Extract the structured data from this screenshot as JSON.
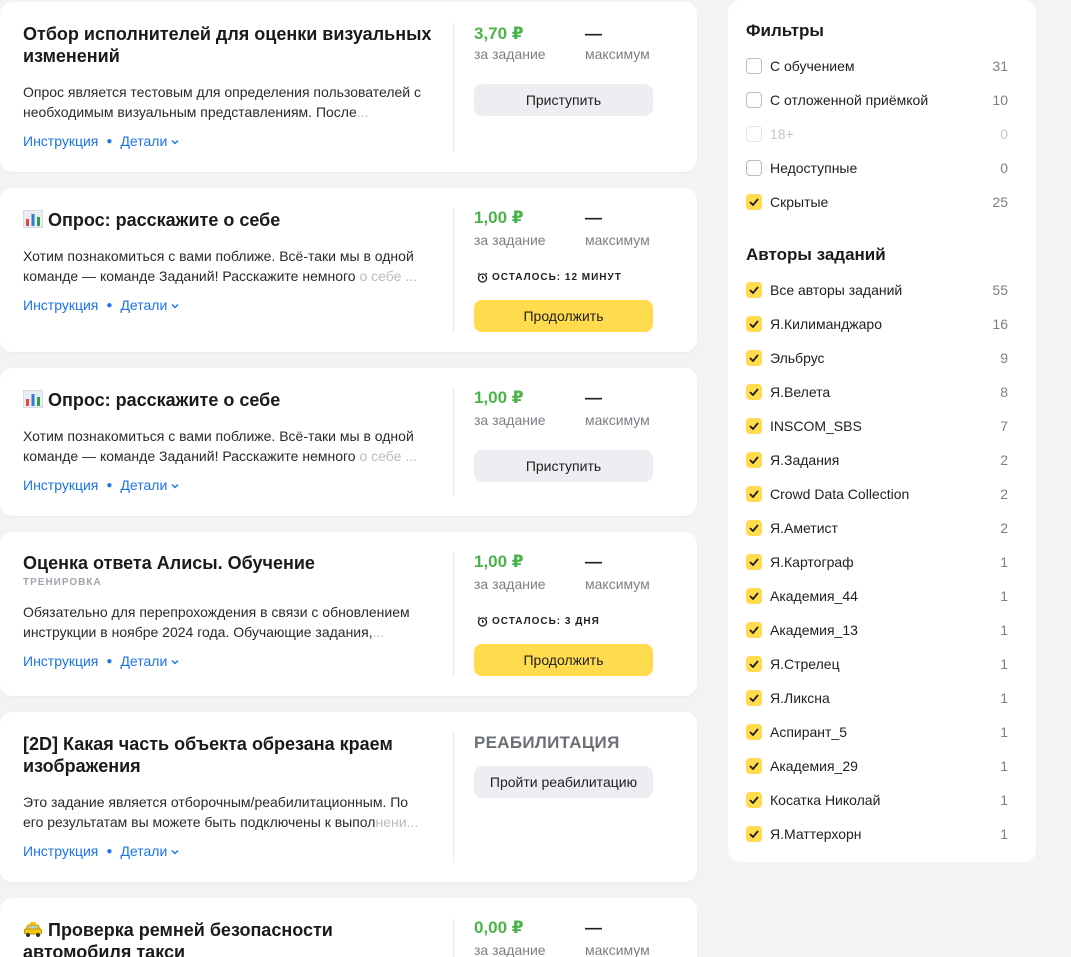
{
  "cards": [
    {
      "title_lines": [
        "Отбор исполнителей для оценки визуальных",
        "изменений"
      ],
      "desc_lines": [
        "Опрос является тестовым для определения пользователей с",
        "необходимым визуальным представлениям. После"
      ],
      "desc_fade": "...",
      "price": "3,70 ₽",
      "price_label": "за задание",
      "max": "—",
      "max_label": "максимум",
      "button": "Приступить",
      "instr": "Инструкция",
      "details": "Детали"
    },
    {
      "title": "Опрос: расскажите о себе",
      "desc_lines": [
        "Хотим познакомиться с вами поближе. Всё-таки мы в одной",
        "команде — команде Заданий! Расскажите немного"
      ],
      "desc_fade": "о себе ...",
      "price": "1,00 ₽",
      "price_label": "за задание",
      "max": "—",
      "max_label": "максимум",
      "timer": "ОСТАЛОСЬ: 12 МИНУТ",
      "button": "Продолжить",
      "instr": "Инструкция",
      "details": "Детали"
    },
    {
      "title": "Опрос: расскажите о себе",
      "desc_lines": [
        "Хотим познакомиться с вами поближе. Всё-таки мы в одной",
        "команде — команде Заданий! Расскажите немного"
      ],
      "desc_fade": "о себе ...",
      "price": "1,00 ₽",
      "price_label": "за задание",
      "max": "—",
      "max_label": "максимум",
      "button": "Приступить",
      "instr": "Инструкция",
      "details": "Детали"
    },
    {
      "title": "Оценка ответа Алисы. Обучение",
      "tag": "ТРЕНИРОВКА",
      "desc_lines": [
        "Обязательно для перепрохождения в связи с обновлением",
        "инструкции в ноябре 2024 года. Обучающие задания,"
      ],
      "desc_fade": "...",
      "price": "1,00 ₽",
      "price_label": "за задание",
      "max": "—",
      "max_label": "максимум",
      "timer": "ОСТАЛОСЬ: 3 ДНЯ",
      "button": "Продолжить",
      "instr": "Инструкция",
      "details": "Детали"
    },
    {
      "title_lines": [
        "[2D] Какая часть объекта обрезана краем",
        "изображения"
      ],
      "desc_lines": [
        "Это задание является отборочным/реабилитационным. По",
        "его результатам вы можете быть подключены к выпол"
      ],
      "desc_fade": "нени...",
      "status": "РЕАБИЛИТАЦИЯ",
      "button": "Пройти реабилитацию",
      "instr": "Инструкция",
      "details": "Детали"
    },
    {
      "title_lines": [
        "Проверка ремней безопасности",
        "автомобиля такси"
      ],
      "price": "0,00 ₽",
      "price_label": "за задание",
      "max": "—",
      "max_label": "максимум"
    }
  ],
  "filters": {
    "title": "Фильтры",
    "items": [
      {
        "label": "С обучением",
        "count": "31",
        "checked": false
      },
      {
        "label": "С отложенной приёмкой",
        "count": "10",
        "checked": false
      },
      {
        "label": "18+",
        "count": "0",
        "checked": false,
        "disabled": true
      },
      {
        "label": "Недоступные",
        "count": "0",
        "checked": false
      },
      {
        "label": "Скрытые",
        "count": "25",
        "checked": true
      }
    ]
  },
  "authors": {
    "title": "Авторы заданий",
    "items": [
      {
        "label": "Все авторы заданий",
        "count": "55"
      },
      {
        "label": "Я.Килиманджаро",
        "count": "16"
      },
      {
        "label": "Эльбрус",
        "count": "9"
      },
      {
        "label": "Я.Велета",
        "count": "8"
      },
      {
        "label": "INSCOM_SBS",
        "count": "7"
      },
      {
        "label": "Я.Задания",
        "count": "2"
      },
      {
        "label": "Crowd Data Collection",
        "count": "2"
      },
      {
        "label": "Я.Аметист",
        "count": "2"
      },
      {
        "label": "Я.Картограф",
        "count": "1"
      },
      {
        "label": "Академия_44",
        "count": "1"
      },
      {
        "label": "Академия_13",
        "count": "1"
      },
      {
        "label": "Я.Стрелец",
        "count": "1"
      },
      {
        "label": "Я.Ликсна",
        "count": "1"
      },
      {
        "label": "Аспирант_5",
        "count": "1"
      },
      {
        "label": "Академия_29",
        "count": "1"
      },
      {
        "label": "Косатка Николай",
        "count": "1"
      },
      {
        "label": "Я.Маттерхорн",
        "count": "1"
      }
    ]
  },
  "colors": {
    "accent_yellow": "#ffdb4d",
    "price_green": "#4bb34b",
    "link_blue": "#1a73e8"
  }
}
